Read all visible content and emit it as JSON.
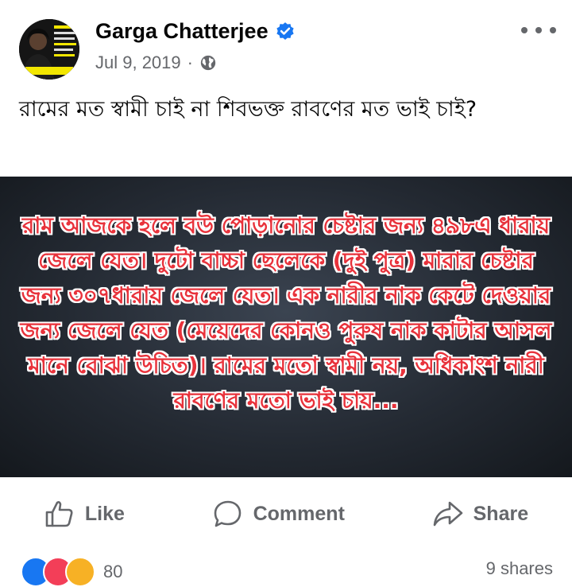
{
  "post": {
    "author": "Garga Chatterjee",
    "date": "Jul 9, 2019",
    "separator": "·",
    "caption": "রামের মত স্বামী চাই না শিবভক্ত রাবণের মত ভাই চাই?",
    "image_text": "রাম আজকে হলে বউ পোড়ানোর চেষ্টার জন্য ৪৯৮এ ধারায় জেলে যেত। দুটো বাচ্চা ছেলেকে (দুই পুত্র) মারার চেষ্টার জন্য ৩০৭ধারায় জেলে যেত। এক নারীর নাক কেটে দেওয়ার জন্য জেলে যেত (মেয়েদের কোনও পুরুষ নাক কাটার আসল মানে বোঝা উচিত)। রামের মতো স্বামী নয়, অধিকাংশ নারী রাবণের মতো ভাই চায়..."
  },
  "actions": {
    "like": "Like",
    "comment": "Comment",
    "share": "Share"
  },
  "footer": {
    "reaction_count": "80",
    "shares": "9 shares"
  },
  "icons": {
    "verified": "verified-badge-icon",
    "globe": "globe-icon",
    "more": "more-options-icon"
  },
  "colors": {
    "verified_blue": "#1877f2",
    "image_text_red": "#e8323b",
    "muted_gray": "#65676b"
  }
}
